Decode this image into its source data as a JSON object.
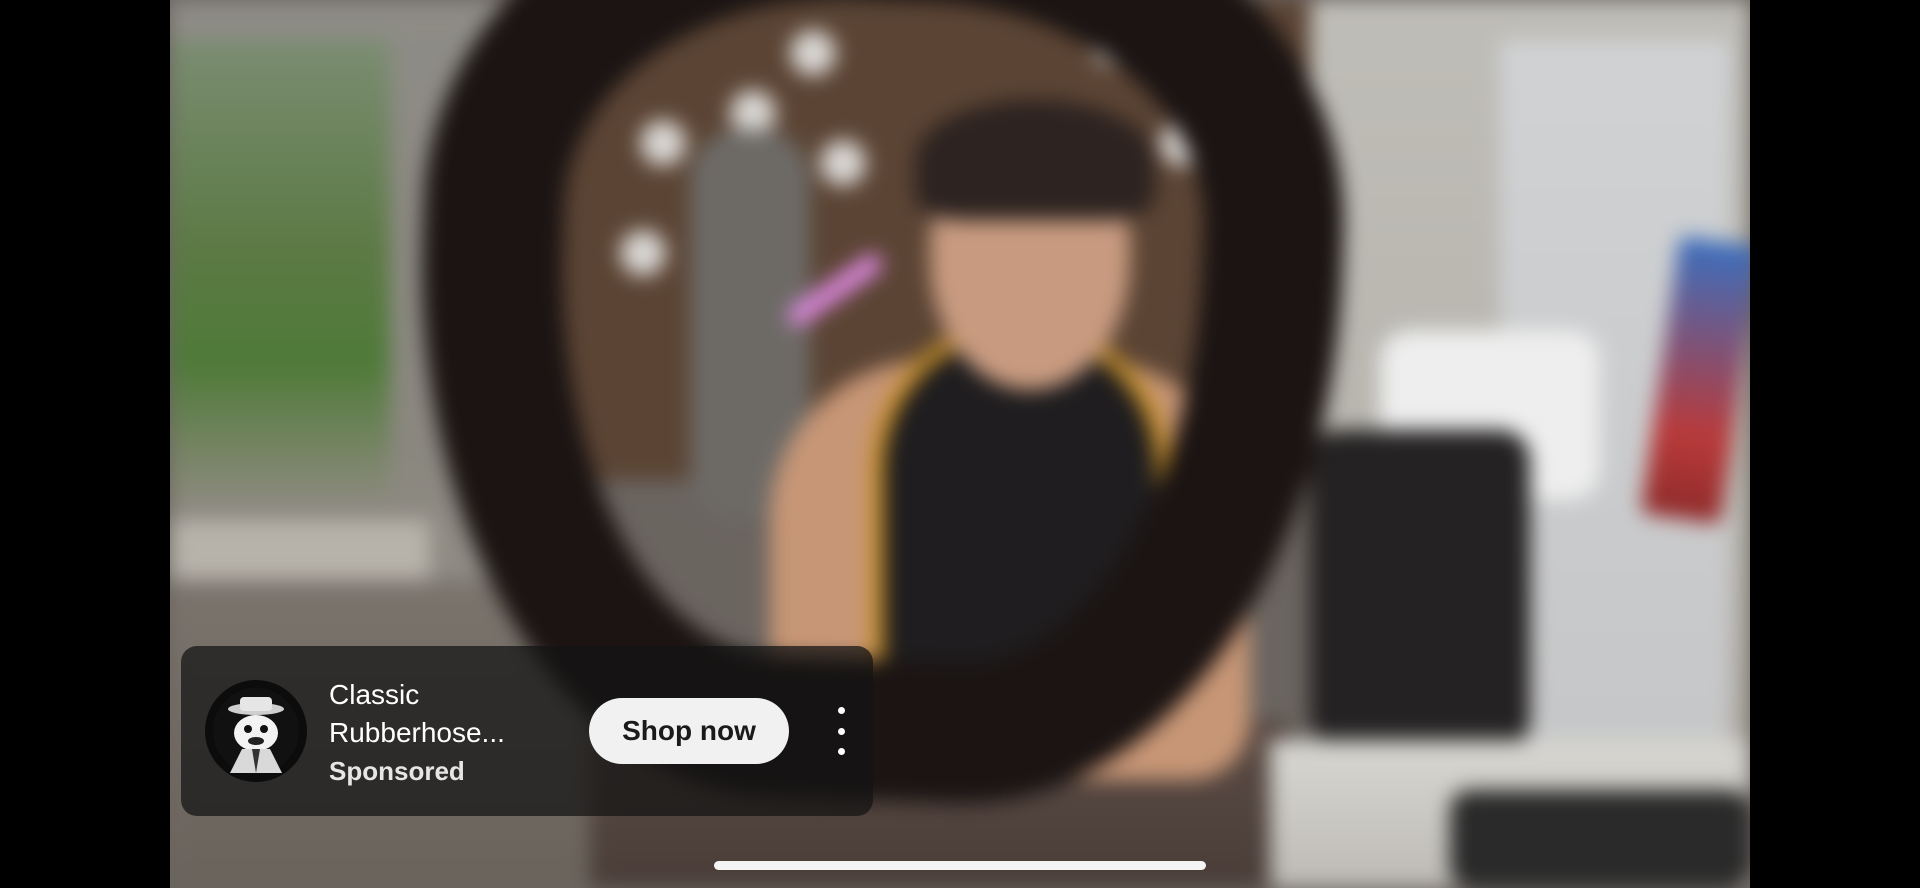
{
  "video": {
    "description_icon": "video-content"
  },
  "ad": {
    "logo_icon": "cartoon-detective-avatar-icon",
    "title": "Classic Rubberhose...",
    "sponsored_label": "Sponsored",
    "cta_label": "Shop now",
    "more_icon": "more-vertical-icon"
  },
  "system": {
    "home_indicator": "home-indicator"
  },
  "colors": {
    "card_bg": "#141414",
    "button_bg": "#f1f1f1",
    "button_text": "#1a1a1a",
    "text_primary": "#ffffff"
  }
}
